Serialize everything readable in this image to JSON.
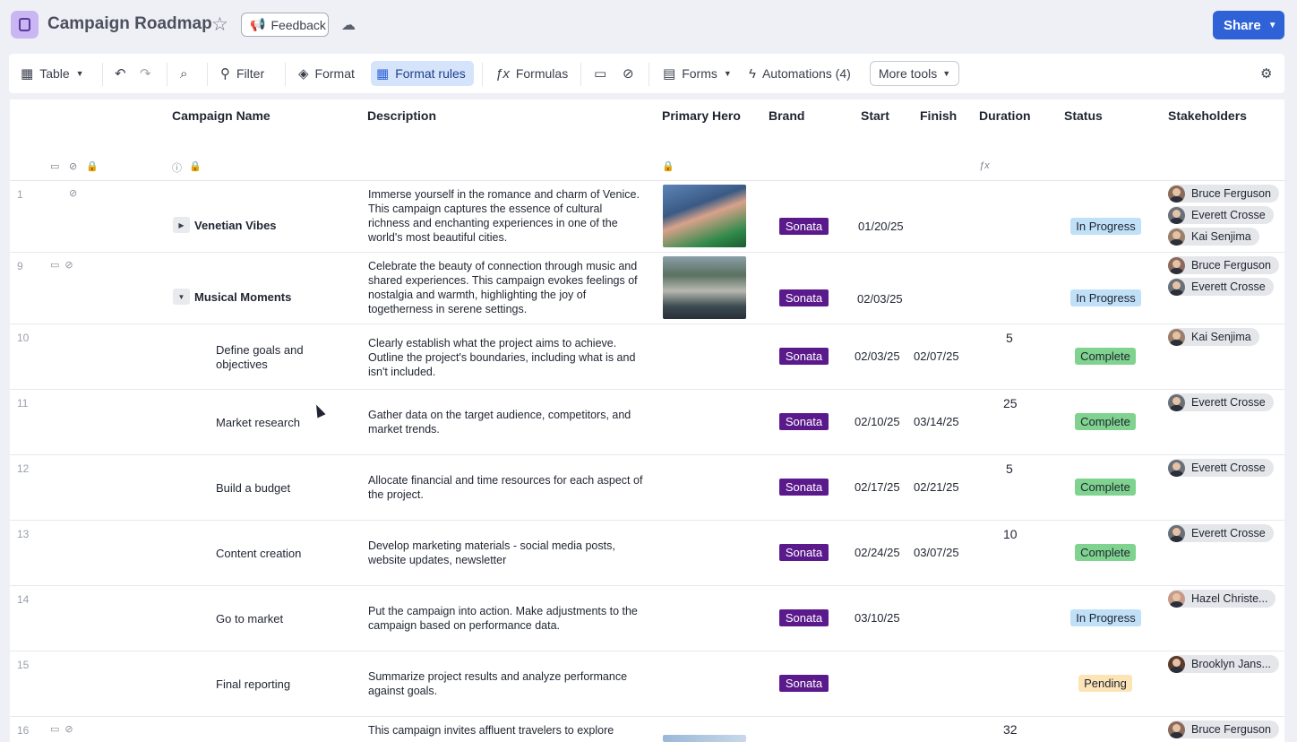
{
  "header": {
    "title": "Campaign Roadmap",
    "feedback_label": "Feedback",
    "share_label": "Share"
  },
  "toolbar": {
    "view_label": "Table",
    "filter_label": "Filter",
    "format_label": "Format",
    "format_rules_label": "Format rules",
    "formulas_label": "Formulas",
    "forms_label": "Forms",
    "automations_label": "Automations (4)",
    "more_tools_label": "More tools"
  },
  "columns": {
    "campaign_name": "Campaign Name",
    "description": "Description",
    "primary_hero": "Primary Hero",
    "brand": "Brand",
    "start": "Start",
    "finish": "Finish",
    "duration": "Duration",
    "status": "Status",
    "stakeholders": "Stakeholders"
  },
  "rows": [
    {
      "num": "1",
      "name": "Venetian Vibes",
      "description": "Immerse yourself in the romance and charm of Venice. This campaign captures the essence of cultural richness and enchanting experiences in one of the world's most beautiful cities.",
      "brand": "Sonata",
      "start": "01/20/25",
      "finish": "",
      "duration": "",
      "status": "In Progress",
      "stakeholders": [
        "Bruce Ferguson",
        "Everett Crosse",
        "Kai Senjima"
      ]
    },
    {
      "num": "9",
      "name": "Musical Moments",
      "description": "Celebrate the beauty of connection through music and shared experiences. This campaign evokes feelings of nostalgia and warmth, highlighting the joy of togetherness in serene settings.",
      "brand": "Sonata",
      "start": "02/03/25",
      "finish": "",
      "duration": "",
      "status": "In Progress",
      "stakeholders": [
        "Bruce Ferguson",
        "Everett Crosse"
      ]
    },
    {
      "num": "10",
      "name": "Define goals and objectives",
      "description": "Clearly establish what the project aims to achieve. Outline the project's boundaries, including what is and isn't included.",
      "brand": "Sonata",
      "start": "02/03/25",
      "finish": "02/07/25",
      "duration": "5",
      "status": "Complete",
      "stakeholders": [
        "Kai Senjima"
      ]
    },
    {
      "num": "11",
      "name": "Market research",
      "description": "Gather data on the target audience, competitors, and market trends.",
      "brand": "Sonata",
      "start": "02/10/25",
      "finish": "03/14/25",
      "duration": "25",
      "status": "Complete",
      "stakeholders": [
        "Everett Crosse"
      ]
    },
    {
      "num": "12",
      "name": "Build a budget",
      "description": "Allocate financial and time resources for each aspect of the project.",
      "brand": "Sonata",
      "start": "02/17/25",
      "finish": "02/21/25",
      "duration": "5",
      "status": "Complete",
      "stakeholders": [
        "Everett Crosse"
      ]
    },
    {
      "num": "13",
      "name": "Content creation",
      "description": "Develop marketing materials - social media posts, website updates, newsletter",
      "brand": "Sonata",
      "start": "02/24/25",
      "finish": "03/07/25",
      "duration": "10",
      "status": "Complete",
      "stakeholders": [
        "Everett Crosse"
      ]
    },
    {
      "num": "14",
      "name": "Go to market",
      "description": "Put the campaign into action. Make adjustments to the campaign based on performance data.",
      "brand": "Sonata",
      "start": "03/10/25",
      "finish": "",
      "duration": "",
      "status": "In Progress",
      "stakeholders": [
        "Hazel Christe..."
      ]
    },
    {
      "num": "15",
      "name": "Final reporting",
      "description": "Summarize project results and analyze performance against goals.",
      "brand": "Sonata",
      "start": "",
      "finish": "",
      "duration": "",
      "status": "Pending",
      "stakeholders": [
        "Brooklyn Jans..."
      ]
    },
    {
      "num": "16",
      "name": "",
      "description": "This campaign invites affluent travelers to explore",
      "brand": "",
      "start": "",
      "finish": "",
      "duration": "32",
      "status": "",
      "stakeholders": [
        "Bruce Ferguson"
      ]
    }
  ]
}
